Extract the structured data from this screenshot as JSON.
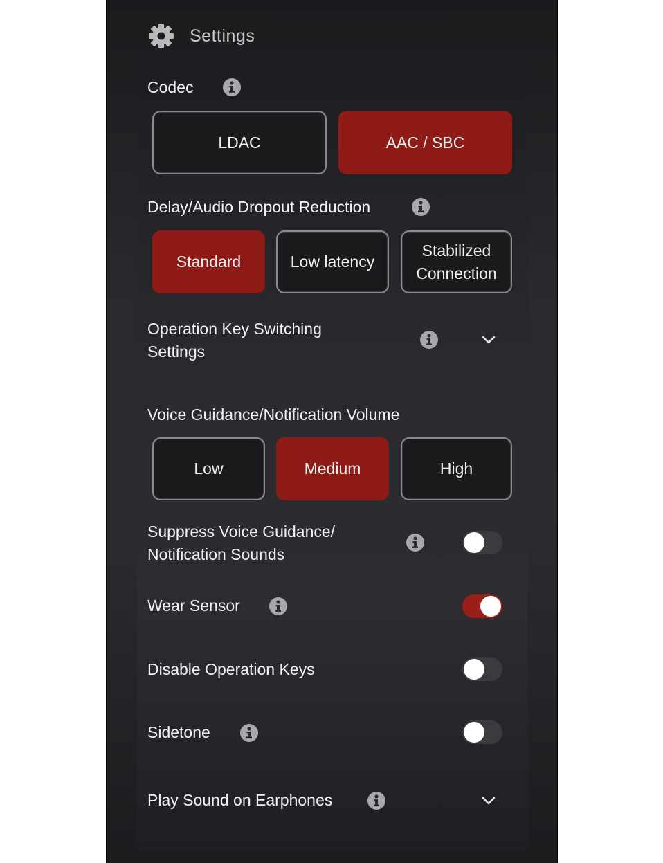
{
  "header": {
    "title": "Settings",
    "icon": "gear-icon"
  },
  "codec": {
    "label": "Codec",
    "options": [
      "LDAC",
      "AAC / SBC"
    ],
    "selected": "AAC / SBC"
  },
  "delay": {
    "label": "Delay/Audio Dropout Reduction",
    "options": [
      "Standard",
      "Low latency",
      "Stabilized Connection"
    ],
    "selected": "Standard"
  },
  "operation_key": {
    "label": "Operation Key Switching Settings"
  },
  "voice_volume": {
    "label": "Voice Guidance/Notification Volume",
    "options": [
      "Low",
      "Medium",
      "High"
    ],
    "selected": "Medium"
  },
  "suppress_voice": {
    "label": "Suppress Voice Guidance/ Notification Sounds",
    "enabled": false
  },
  "wear_sensor": {
    "label": "Wear Sensor",
    "enabled": true
  },
  "disable_keys": {
    "label": "Disable Operation Keys",
    "enabled": false
  },
  "sidetone": {
    "label": "Sidetone",
    "enabled": false
  },
  "play_sound": {
    "label": "Play Sound on Earphones"
  },
  "colors": {
    "accent": "#8e1b16",
    "toggle_on": "#9b1f19",
    "toggle_off": "#3b3a3f",
    "icon_gray": "#a8a8ab"
  }
}
